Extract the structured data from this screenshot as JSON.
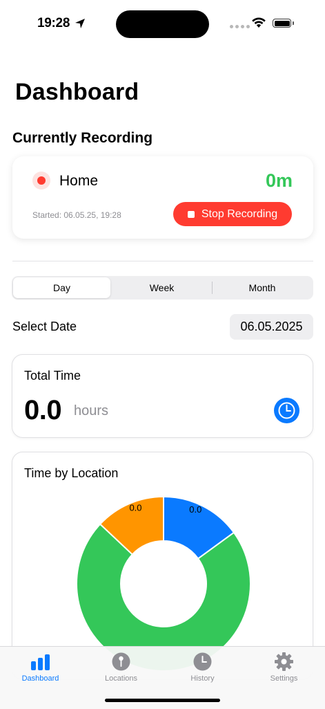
{
  "status_bar": {
    "time": "19:28"
  },
  "page": {
    "title": "Dashboard"
  },
  "recording": {
    "section_title": "Currently Recording",
    "location": "Home",
    "duration": "0m",
    "started": "Started: 06.05.25, 19:28",
    "stop_label": "Stop Recording"
  },
  "period_picker": {
    "options": [
      "Day",
      "Week",
      "Month"
    ],
    "selected": "Day"
  },
  "date_select": {
    "label": "Select Date",
    "value": "06.05.2025"
  },
  "total_time": {
    "title": "Total Time",
    "value": "0.0",
    "unit": "hours"
  },
  "time_by_location": {
    "title": "Time by Location",
    "chart_data": {
      "type": "pie",
      "donut": true,
      "slices": [
        {
          "label": "0.0",
          "fraction": 0.15,
          "color": "#0a7aff"
        },
        {
          "label": "",
          "fraction": 0.72,
          "color": "#34c759"
        },
        {
          "label": "0.0",
          "fraction": 0.13,
          "color": "#ff9500"
        }
      ]
    }
  },
  "tabs": [
    {
      "label": "Dashboard",
      "icon": "bar-chart-icon",
      "active": true
    },
    {
      "label": "Locations",
      "icon": "pin-icon",
      "active": false
    },
    {
      "label": "History",
      "icon": "clock-icon",
      "active": false
    },
    {
      "label": "Settings",
      "icon": "gear-icon",
      "active": false
    }
  ],
  "colors": {
    "accent": "#0a7aff",
    "record": "#ff3b30",
    "duration": "#34c759"
  }
}
